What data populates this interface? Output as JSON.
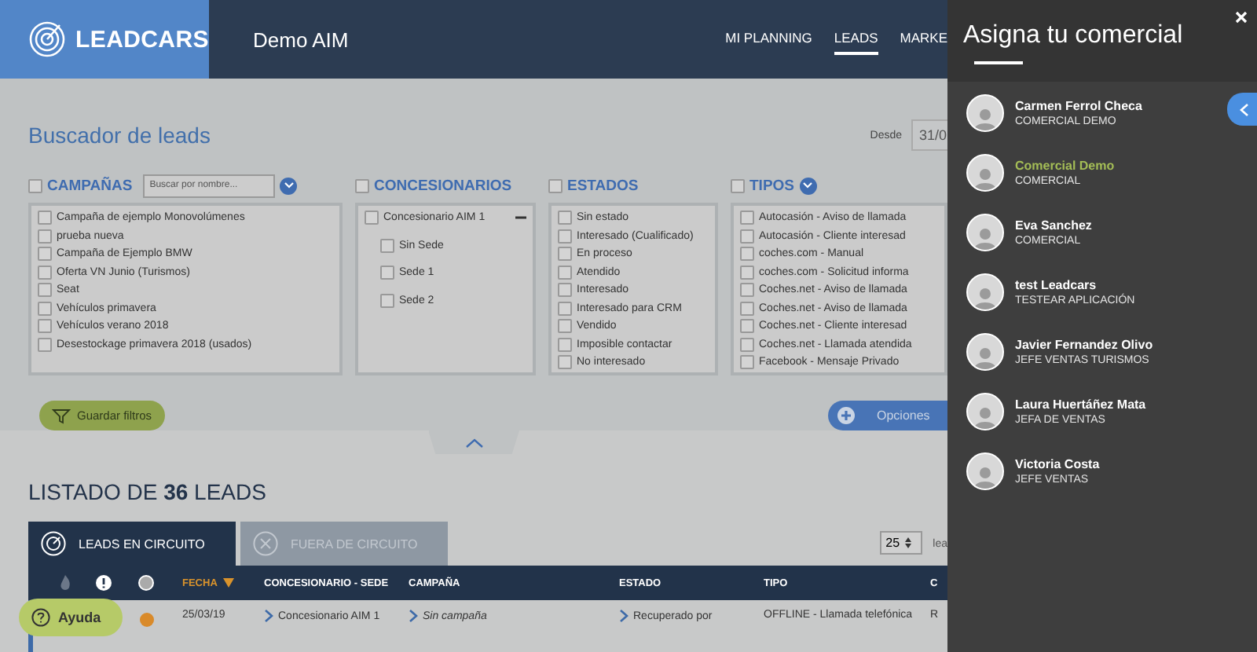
{
  "header": {
    "logo": "LEADCARS",
    "account": "Demo AIM",
    "nav": [
      {
        "label": "MI PLANNING",
        "selected": false
      },
      {
        "label": "LEADS",
        "selected": true
      },
      {
        "label": "MARKE",
        "selected": false
      }
    ]
  },
  "search": {
    "title": "Buscador de leads",
    "date_label": "Desde",
    "date_value": "31/0"
  },
  "filters": {
    "campaigns": {
      "title": "CAMPAÑAS",
      "checked": false,
      "placeholder": "Buscar por nombre...",
      "items": [
        {
          "label": "Campaña de ejemplo Monovolúmenes",
          "checked": false
        },
        {
          "label": "prueba nueva",
          "checked": false
        },
        {
          "label": "Campaña de Ejemplo BMW",
          "checked": false
        },
        {
          "label": "Oferta VN Junio (Turismos)",
          "checked": false
        },
        {
          "label": "Seat",
          "checked": false
        },
        {
          "label": "Vehículos primavera",
          "checked": false
        },
        {
          "label": "Vehículos verano 2018",
          "checked": false
        },
        {
          "label": "Desestockage primavera 2018 (usados)",
          "checked": false
        }
      ]
    },
    "dealers": {
      "title": "CONCESIONARIOS",
      "checked": false,
      "items": [
        {
          "label": "Concesionario AIM 1",
          "checked": false,
          "expanded": true,
          "children": [
            {
              "label": "Sin Sede",
              "checked": false
            },
            {
              "label": "Sede 1",
              "checked": false
            },
            {
              "label": "Sede 2",
              "checked": false
            }
          ]
        }
      ]
    },
    "states": {
      "title": "ESTADOS",
      "checked": false,
      "items": [
        {
          "label": "Sin estado",
          "checked": false
        },
        {
          "label": "Interesado (Cualificado)",
          "checked": false
        },
        {
          "label": "En proceso",
          "checked": false
        },
        {
          "label": "Atendido",
          "checked": false
        },
        {
          "label": "Interesado",
          "checked": false
        },
        {
          "label": "Interesado para CRM",
          "checked": false
        },
        {
          "label": "Vendido",
          "checked": false
        },
        {
          "label": "Imposible contactar",
          "checked": false
        },
        {
          "label": "No interesado",
          "checked": false
        }
      ]
    },
    "types": {
      "title": "TIPOS",
      "checked": false,
      "items": [
        {
          "label": "Autocasión - Aviso de llamada",
          "checked": false
        },
        {
          "label": "Autocasión - Cliente interesad",
          "checked": false
        },
        {
          "label": "coches.com - Manual",
          "checked": false
        },
        {
          "label": "coches.com - Solicitud informa",
          "checked": false
        },
        {
          "label": "Coches.net - Aviso de llamada",
          "checked": false
        },
        {
          "label": "Coches.net - Aviso de llamada",
          "checked": false
        },
        {
          "label": "Coches.net - Cliente interesad",
          "checked": false
        },
        {
          "label": "Coches.net - Llamada atendida",
          "checked": false
        },
        {
          "label": "Facebook - Mensaje Privado",
          "checked": false
        }
      ]
    }
  },
  "buttons": {
    "save_filters": "Guardar filtros",
    "options": "Opciones"
  },
  "listing": {
    "title": "LISTADO DE **36** LEADS",
    "tabs": [
      {
        "label": "LEADS EN CIRCUITO",
        "selected": true
      },
      {
        "label": "FUERA DE CIRCUITO",
        "selected": false
      }
    ],
    "page_size": "25",
    "page_size_label": "lea",
    "columns": [
      "FECHA",
      "CONCESIONARIO - SEDE",
      "CAMPAÑA",
      "ESTADO",
      "TIPO",
      "C"
    ],
    "rows": [
      {
        "color": "#d98a2a",
        "date": "25/03/19",
        "dealer": "Concesionario AIM 1",
        "campaign": "Sin campaña",
        "state": "Recuperado por",
        "type": "OFFLINE - Llamada telefónica",
        "client": "R"
      }
    ]
  },
  "help": "Ayuda",
  "drawer": {
    "title": "Asigna tu comercial",
    "items": [
      {
        "name": "Carmen Ferrol Checa",
        "role": "COMERCIAL DEMO",
        "selected": false
      },
      {
        "name": "Comercial Demo",
        "role": "COMERCIAL",
        "selected": true
      },
      {
        "name": "Eva Sanchez",
        "role": "COMERCIAL",
        "selected": false
      },
      {
        "name": "test Leadcars",
        "role": "TESTEAR APLICACIÓN",
        "selected": false
      },
      {
        "name": "Javier Fernandez Olivo",
        "role": "JEFE VENTAS TURISMOS",
        "selected": false
      },
      {
        "name": "Laura Huertáñez Mata",
        "role": "JEFA DE VENTAS",
        "selected": false
      },
      {
        "name": "Victoria Costa",
        "role": "JEFE VENTAS",
        "selected": false
      }
    ]
  }
}
